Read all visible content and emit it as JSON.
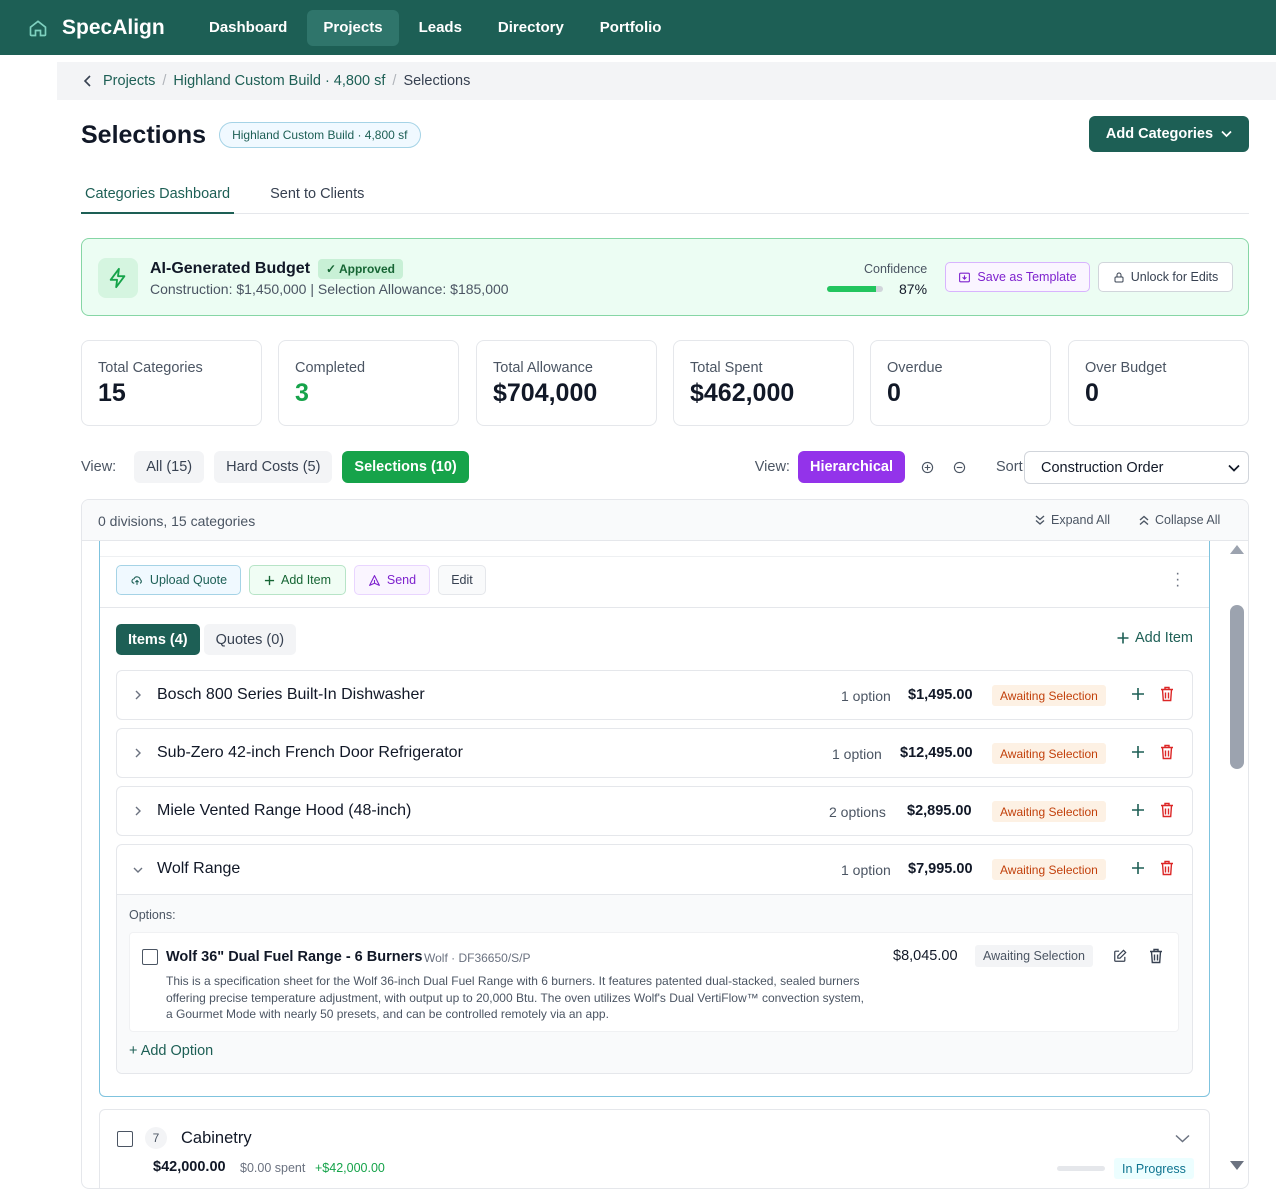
{
  "app": {
    "name": "SpecAlign"
  },
  "nav": {
    "items": [
      {
        "label": "Dashboard",
        "active": false
      },
      {
        "label": "Projects",
        "active": true
      },
      {
        "label": "Leads",
        "active": false
      },
      {
        "label": "Directory",
        "active": false
      },
      {
        "label": "Portfolio",
        "active": false
      }
    ]
  },
  "breadcrumb": {
    "back_icon": "chevron-left-icon",
    "items": [
      "Projects",
      "Highland Custom Build · 4,800 sf",
      "Selections"
    ],
    "separator": "/"
  },
  "header": {
    "title": "Selections",
    "project_badge": "Highland Custom Build · 4,800 sf",
    "add_categories_label": "Add Categories"
  },
  "tabs": [
    {
      "label": "Categories Dashboard",
      "active": true
    },
    {
      "label": "Sent to Clients",
      "active": false
    }
  ],
  "ai_budget": {
    "icon": "lightning-icon",
    "title": "AI-Generated Budget",
    "status": "Approved",
    "summary": "Construction: $1,450,000 | Selection Allowance: $185,000",
    "confidence_label": "Confidence",
    "confidence_value": "87%",
    "confidence_fraction": 0.87,
    "save_template_label": "Save as Template",
    "unlock_label": "Unlock for Edits"
  },
  "stats": [
    {
      "label": "Total Categories",
      "value": "15"
    },
    {
      "label": "Completed",
      "value": "3"
    },
    {
      "label": "Total Allowance",
      "value": "$704,000"
    },
    {
      "label": "Total Spent",
      "value": "$462,000"
    },
    {
      "label": "Overdue",
      "value": "0"
    },
    {
      "label": "Over Budget",
      "value": "0"
    }
  ],
  "filters": {
    "view_label": "View:",
    "chips": [
      "All (15)",
      "Hard Costs (5)",
      "Selections (10)"
    ],
    "mode_label": "View:",
    "mode_value": "Hierarchical",
    "sort_label": "Sort:",
    "sort_value": "Construction Order"
  },
  "panel": {
    "count_text": "0 divisions, 15 categories",
    "expand_all": "Expand All",
    "collapse_all": "Collapse All"
  },
  "category": {
    "actions": {
      "upload_quote": "Upload Quote",
      "add_item": "Add Item",
      "send": "Send",
      "edit": "Edit"
    },
    "item_tabs": [
      "Items (4)",
      "Quotes (0)"
    ],
    "add_item_link": "Add Item",
    "items": [
      {
        "name": "Bosch 800 Series Built-In Dishwasher",
        "options": "1 option",
        "price": "$1,495.00",
        "status": "Awaiting Selection"
      },
      {
        "name": "Sub-Zero 42-inch French Door Refrigerator",
        "options": "1 option",
        "price": "$12,495.00",
        "status": "Awaiting Selection"
      },
      {
        "name": "Miele Vented Range Hood (48-inch)",
        "options": "2 options",
        "price": "$2,895.00",
        "status": "Awaiting Selection"
      },
      {
        "name": "Wolf Range",
        "options": "1 option",
        "price": "$7,995.00",
        "status": "Awaiting Selection"
      }
    ],
    "options_label": "Options:",
    "option": {
      "title": "Wolf 36\" Dual Fuel Range - 6 Burners",
      "meta": "Wolf · DF36650/S/P",
      "description": "This is a specification sheet for the Wolf 36-inch Dual Fuel Range with 6 burners. It features patented dual-stacked, sealed burners offering precise temperature adjustment, with output up to 20,000 Btu. The oven utilizes Wolf's Dual VertiFlow™ convection system, a Gourmet Mode with nearly 50 presets, and can be controlled remotely via an app.",
      "price": "$8,045.00",
      "status": "Awaiting Selection"
    },
    "add_option": "+ Add Option"
  },
  "next_category": {
    "number": "7",
    "name": "Cabinetry",
    "amount": "$42,000.00",
    "spent": "$0.00 spent",
    "remaining": "+$42,000.00",
    "status": "In Progress"
  },
  "colors": {
    "brand": "#1d5f55",
    "success": "#16a34a",
    "accent_purple": "#9333ea",
    "warning": "#c2410c"
  }
}
